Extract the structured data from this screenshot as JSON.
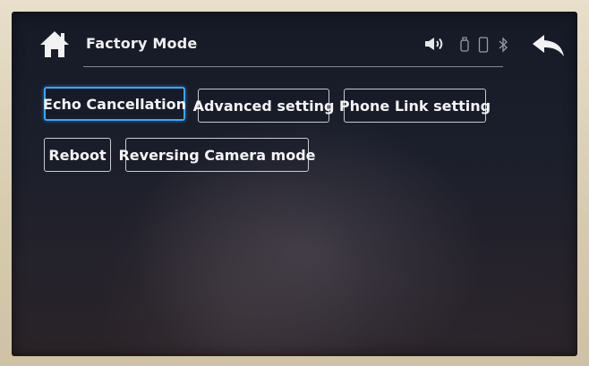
{
  "header": {
    "title": "Factory Mode",
    "home_icon": "home-icon",
    "back_icon": "back-arrow-icon",
    "status_icons": [
      "volume-icon",
      "usb-icon",
      "phone-icon",
      "bluetooth-icon"
    ]
  },
  "menu": {
    "buttons": [
      {
        "label": "Echo Cancellation",
        "selected": true
      },
      {
        "label": "Advanced setting"
      },
      {
        "label": "Phone Link setting"
      },
      {
        "label": "Reboot"
      },
      {
        "label": "Reversing Camera mode"
      }
    ]
  },
  "colors": {
    "accent": "#3aa6ff",
    "text": "#f4f4f4",
    "button_border": "#c8cbd2",
    "screen_bg": "#1b1f2b"
  }
}
